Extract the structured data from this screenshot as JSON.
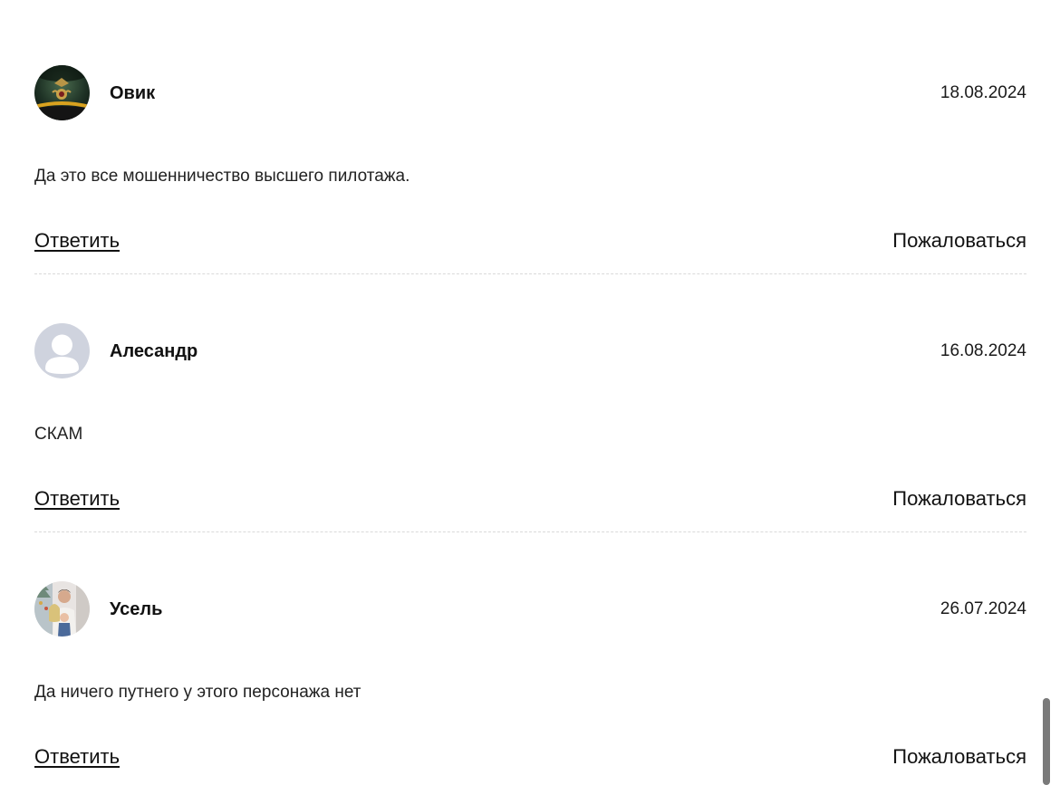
{
  "comments": [
    {
      "avatar": "military-cap-photo",
      "author": "Овик",
      "date": "18.08.2024",
      "text": "Да это все мошенничество высшего пилотажа.",
      "reply_label": "Ответить",
      "report_label": "Пожаловаться"
    },
    {
      "avatar": "default-user-icon",
      "author": "Алесандр",
      "date": "16.08.2024",
      "text": "СКАМ",
      "reply_label": "Ответить",
      "report_label": "Пожаловаться"
    },
    {
      "avatar": "family-photo",
      "author": "Усель",
      "date": "26.07.2024",
      "text": "Да ничего путнего у этого персонажа нет",
      "reply_label": "Ответить",
      "report_label": "Пожаловаться"
    }
  ]
}
